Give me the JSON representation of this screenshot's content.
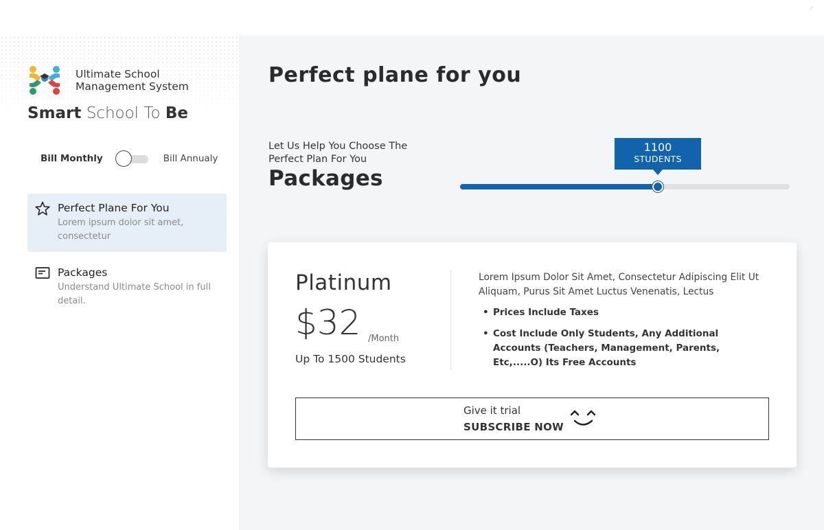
{
  "brand": {
    "line1": "Ultimate School",
    "line2": "Management System",
    "tagline_word1": "Smart",
    "tagline_word2": "School",
    "tagline_word3": "To",
    "tagline_word4": "Be",
    "logo_colors": [
      "#f2b829",
      "#3fb0d8",
      "#2f9a6c",
      "#d9453d",
      "#3b7fc4"
    ]
  },
  "billing": {
    "monthly_label": "Bill Monthly",
    "annual_label": "Bill Annualy",
    "annual_selected": false
  },
  "sidebar": {
    "items": [
      {
        "title": "Perfect Plane For You",
        "desc": "Lorem ipsum dolor sit amet, consectetur",
        "icon": "star-icon",
        "active": true
      },
      {
        "title": "Packages",
        "desc": "Understand Ultimate School in full detail.",
        "icon": "document-icon",
        "active": false
      }
    ]
  },
  "main": {
    "heading": "Perfect plane for you",
    "help_text": "Let Us Help You Choose The Perfect Plan For You",
    "packages_title": "Packages"
  },
  "slider": {
    "value": "1100",
    "unit_label": "STUDENTS",
    "fill_fraction": 0.6,
    "accent_color": "#1163ad"
  },
  "plan": {
    "name": "Platinum",
    "price": "$32",
    "period": "/Month",
    "students": "Up To 1500 Students",
    "description": "Lorem Ipsum Dolor Sit Amet, Consectetur Adipiscing Elit Ut Aliquam, Purus Sit Amet Luctus Venenatis, Lectus",
    "features": [
      "Prices Include Taxes",
      "Cost Include Only Students, Any Additional Accounts (Teachers, Management, Parents, Etc,.....O) Its Free Accounts"
    ],
    "cta_small": "Give it trial",
    "cta_big": "SUBSCRIBE NOW",
    "cta_icon": "smile-icon"
  }
}
